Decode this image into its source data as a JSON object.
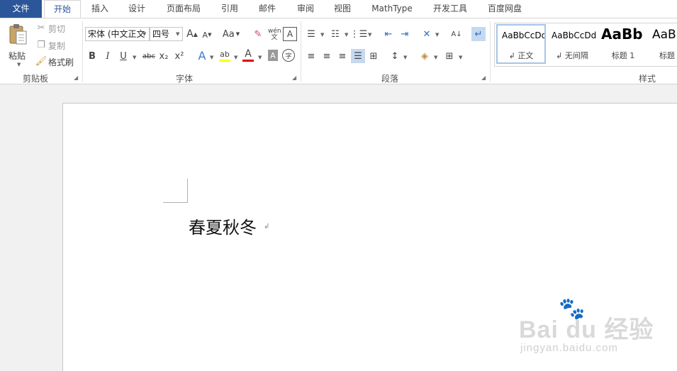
{
  "tabs": [
    {
      "label": "文件"
    },
    {
      "label": "开始"
    },
    {
      "label": "插入"
    },
    {
      "label": "设计"
    },
    {
      "label": "页面布局"
    },
    {
      "label": "引用"
    },
    {
      "label": "邮件"
    },
    {
      "label": "审阅"
    },
    {
      "label": "视图"
    },
    {
      "label": "MathType"
    },
    {
      "label": "开发工具"
    },
    {
      "label": "百度网盘"
    }
  ],
  "clipboard": {
    "paste_label": "粘贴",
    "cut_label": "剪切",
    "copy_label": "复制",
    "format_painter_label": "格式刷",
    "group_label": "剪贴板"
  },
  "font": {
    "font_name": "宋体 (中文正文",
    "font_size": "四号",
    "group_label": "字体",
    "bold": "B",
    "italic": "I",
    "underline": "U",
    "strike": "abc",
    "subscript": "x₂",
    "superscript": "x²",
    "change_case": "Aa",
    "phonetic": "wén 文",
    "highlight_color": "#ffff00",
    "font_color": "#e00000"
  },
  "paragraph": {
    "group_label": "段落"
  },
  "styles": {
    "group_label": "样式",
    "items": [
      {
        "preview": "AaBbCcDd",
        "name": "↲ 正文"
      },
      {
        "preview": "AaBbCcDd",
        "name": "↲ 无间隔"
      },
      {
        "preview": "AaBb",
        "name": "标题 1"
      },
      {
        "preview": "AaB",
        "name": "标题"
      }
    ]
  },
  "document": {
    "text": "春夏秋冬",
    "para_mark": "↲"
  },
  "watermark": {
    "brand": "Bai du 经验",
    "url": "jingyan.baidu.com"
  },
  "colors": {
    "file_tab": "#2b579a",
    "accent": "#2b579a"
  }
}
